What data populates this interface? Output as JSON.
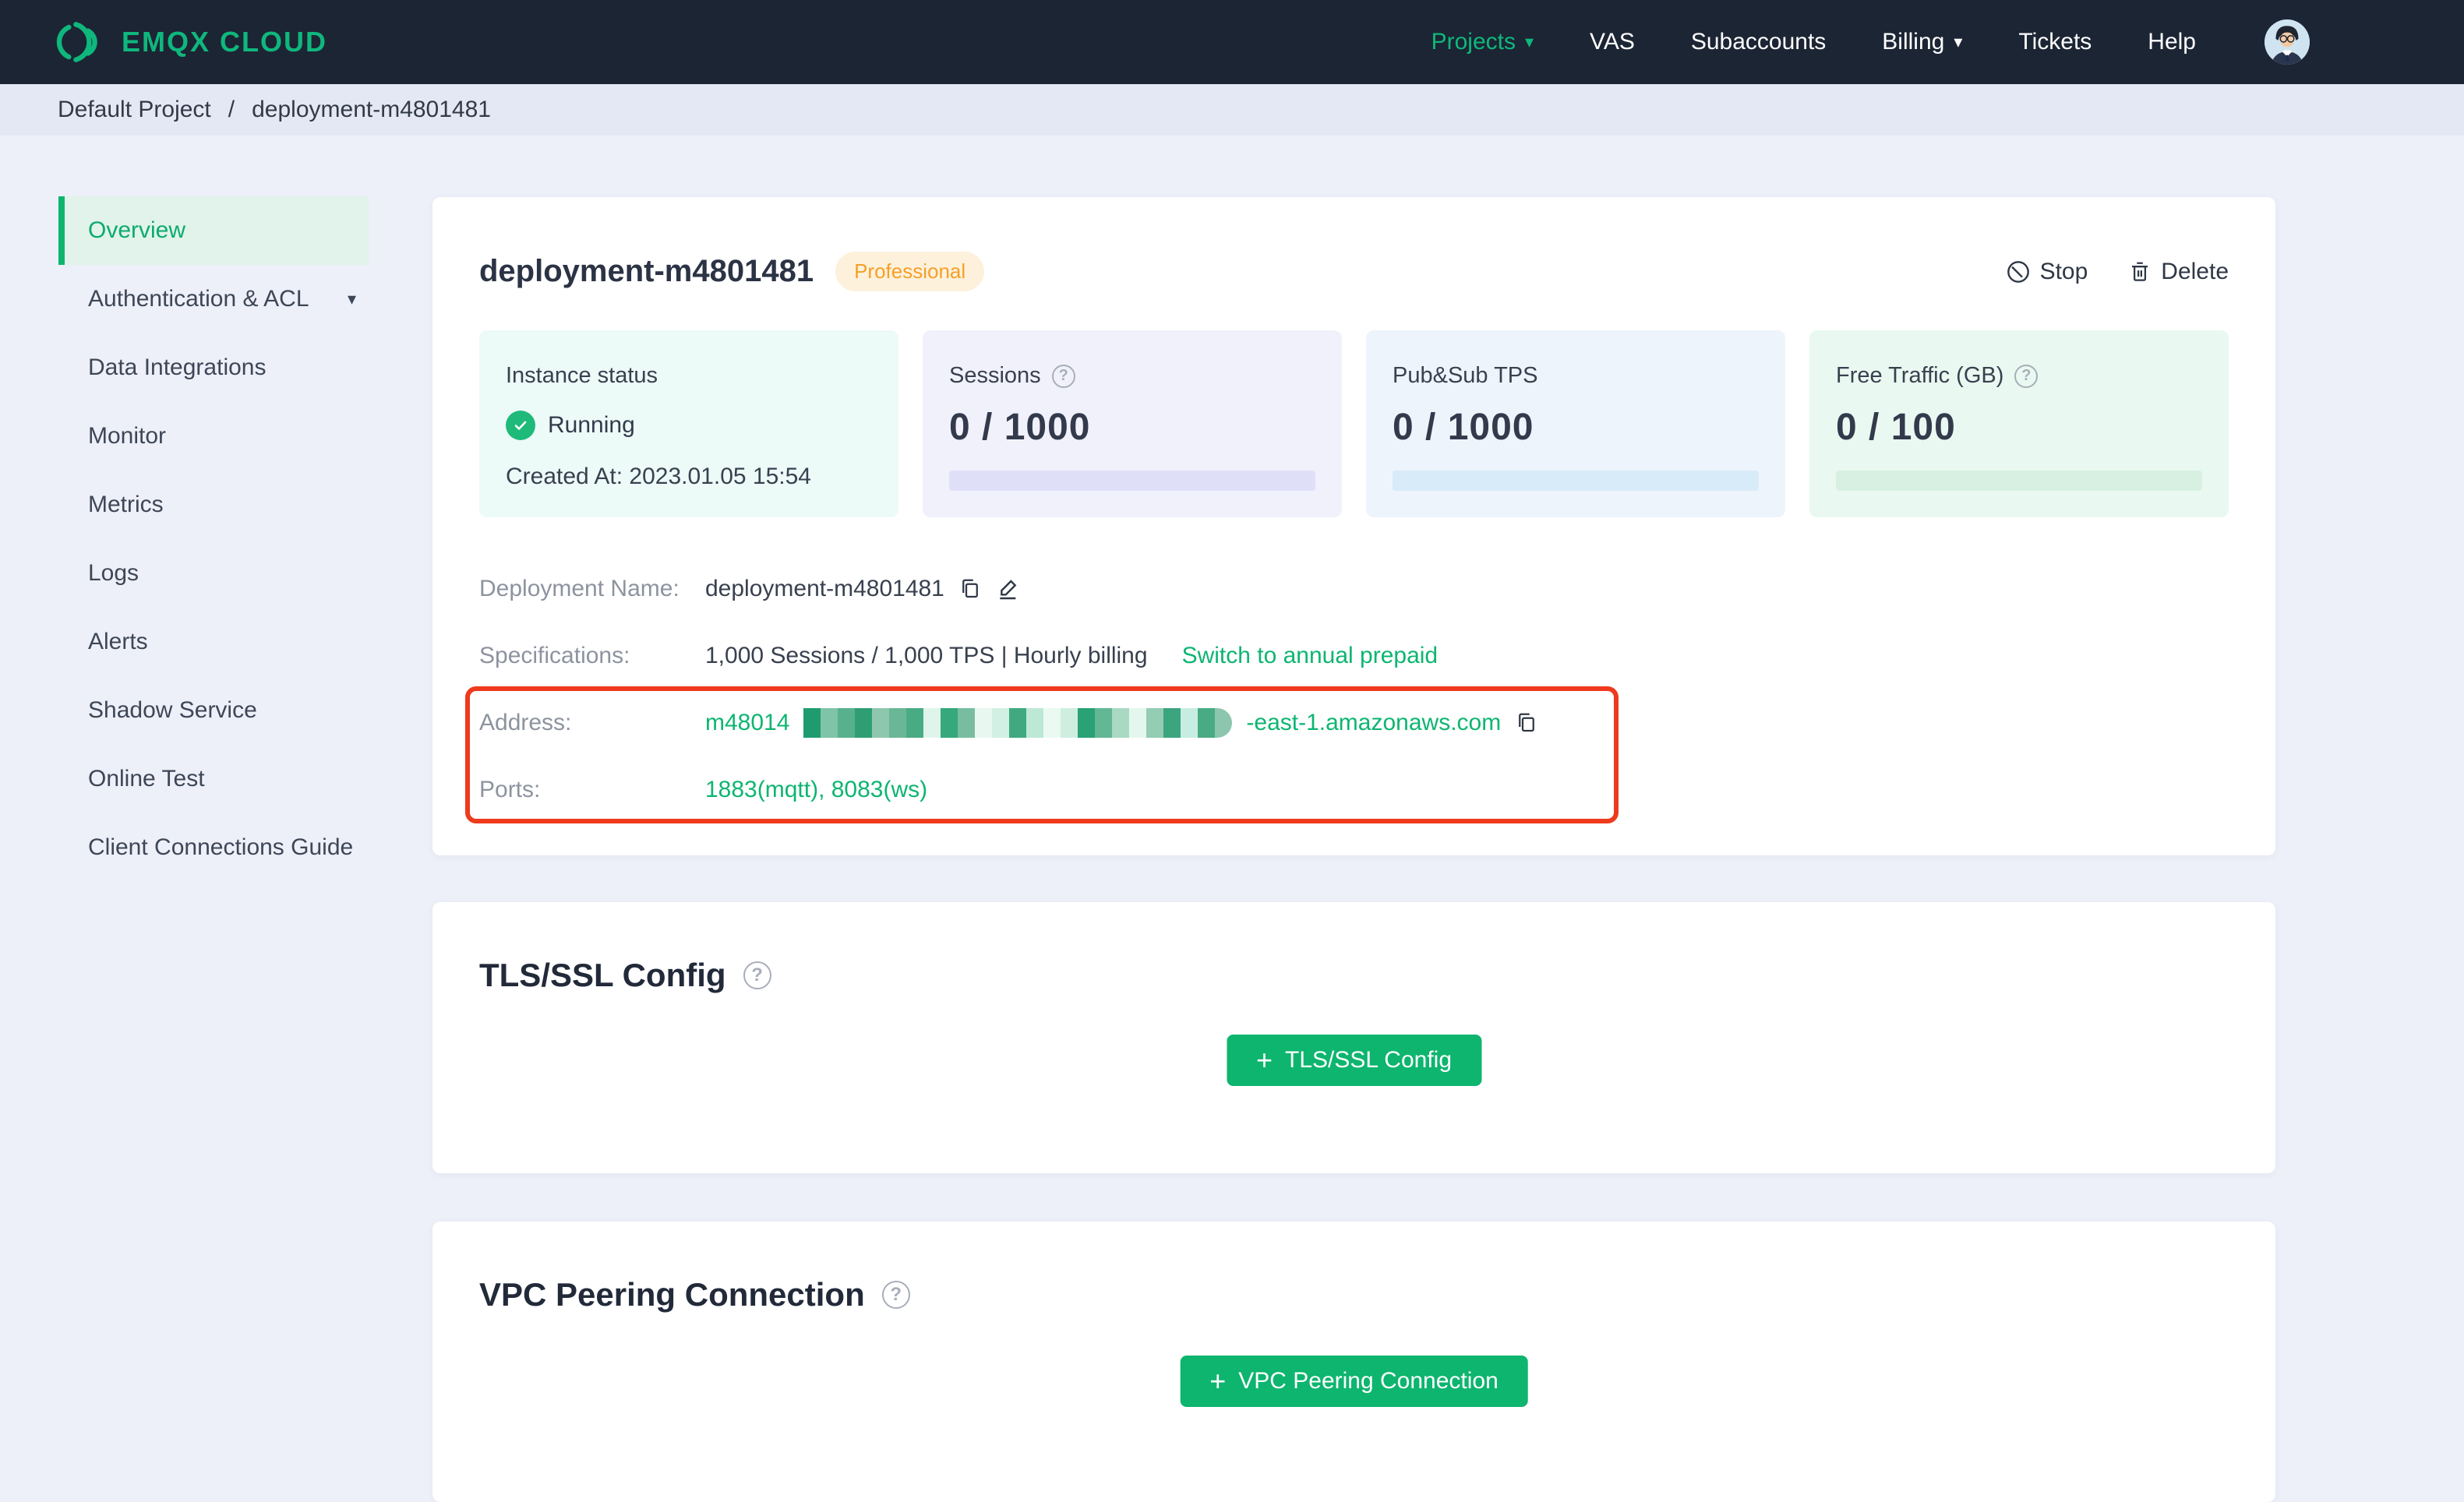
{
  "navbar": {
    "brand": "EMQX CLOUD",
    "items": [
      {
        "label": "Projects",
        "active": true,
        "has_caret": true
      },
      {
        "label": "VAS"
      },
      {
        "label": "Subaccounts"
      },
      {
        "label": "Billing",
        "has_caret": true
      },
      {
        "label": "Tickets"
      },
      {
        "label": "Help"
      }
    ]
  },
  "breadcrumb": {
    "project": "Default Project",
    "separator": "/",
    "current": "deployment-m4801481"
  },
  "sidebar": {
    "items": [
      {
        "label": "Overview",
        "active": true
      },
      {
        "label": "Authentication & ACL",
        "has_caret": true
      },
      {
        "label": "Data Integrations"
      },
      {
        "label": "Monitor"
      },
      {
        "label": "Metrics"
      },
      {
        "label": "Logs"
      },
      {
        "label": "Alerts"
      },
      {
        "label": "Shadow Service"
      },
      {
        "label": "Online Test"
      },
      {
        "label": "Client Connections Guide"
      }
    ]
  },
  "deployment": {
    "title": "deployment-m4801481",
    "plan_badge": "Professional",
    "actions": {
      "stop": "Stop",
      "delete": "Delete"
    },
    "stats": {
      "instance": {
        "label": "Instance status",
        "status": "Running",
        "created_at": "Created At: 2023.01.05 15:54"
      },
      "sessions": {
        "label": "Sessions",
        "value": "0 / 1000"
      },
      "tps": {
        "label": "Pub&Sub TPS",
        "value": "0 / 1000"
      },
      "traffic": {
        "label": "Free Traffic (GB)",
        "value": "0 / 100"
      }
    },
    "details": {
      "name": {
        "label": "Deployment Name:",
        "value": "deployment-m4801481"
      },
      "specifications": {
        "label": "Specifications:",
        "value": "1,000 Sessions / 1,000 TPS | Hourly billing",
        "link": "Switch to annual prepaid"
      },
      "address": {
        "label": "Address:",
        "visible_prefix": "m48014",
        "visible_suffix": "-east-1.amazonaws.com",
        "redacted_blocks": [
          "#1f9c6f",
          "#7fc3a8",
          "#57b18d",
          "#2f9e74",
          "#8fc7ae",
          "#6ab795",
          "#49ab83",
          "#dff5ec",
          "#35a87c",
          "#79bda1",
          "#e8f8f1",
          "#d2f0e3",
          "#41a980",
          "#bde8d6",
          "#eafaf3",
          "#cfeee0",
          "#2aa176",
          "#63b794",
          "#a9d8c3",
          "#e4f7ee",
          "#94ccb4",
          "#3aa57e",
          "#c7ede2",
          "#49ab83",
          "#8cc6ae"
        ]
      },
      "ports": {
        "label": "Ports:",
        "value": "1883(mqtt), 8083(ws)"
      }
    }
  },
  "sections": {
    "tls": {
      "title": "TLS/SSL Config",
      "button_label": "TLS/SSL Config"
    },
    "vpc": {
      "title": "VPC Peering Connection",
      "button_label": "VPC Peering Connection"
    }
  },
  "icons": {
    "help": "?",
    "caret_down": "▾",
    "plus": "+"
  },
  "colors": {
    "navbar_bg": "#1C2534",
    "brand_green": "#0FB77C",
    "button_green": "#0DB56E",
    "link_green": "#0DB572",
    "status_green": "#1FBA7A",
    "badge_bg": "#FDF1DC",
    "badge_text": "#F5A028",
    "highlight_red": "#EE3A1D"
  }
}
